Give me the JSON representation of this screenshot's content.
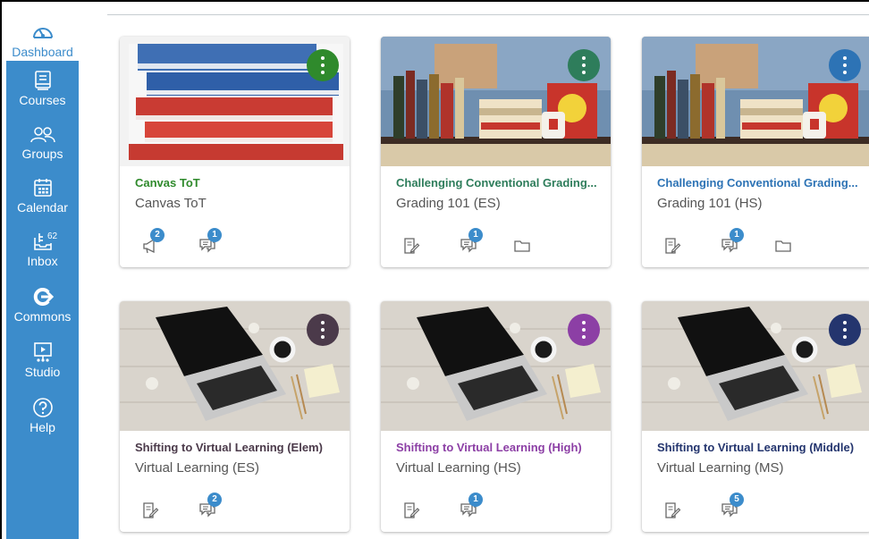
{
  "sidebar": {
    "items": [
      {
        "label": "Dashboard",
        "icon": "dashboard-gauge-icon",
        "active": true
      },
      {
        "label": "Courses",
        "icon": "book-icon"
      },
      {
        "label": "Groups",
        "icon": "groups-people-icon"
      },
      {
        "label": "Calendar",
        "icon": "calendar-icon"
      },
      {
        "label": "Inbox",
        "icon": "inbox-icon",
        "count": "62"
      },
      {
        "label": "Commons",
        "icon": "commons-icon"
      },
      {
        "label": "Studio",
        "icon": "studio-icon"
      },
      {
        "label": "Help",
        "icon": "help-circle-icon"
      }
    ]
  },
  "colors": {
    "sidebar": "#3c8ccb",
    "badge": "#3c8ccb"
  },
  "cards": [
    {
      "title": "Canvas ToT",
      "subtitle": "Canvas ToT",
      "color": "#2f8a2c",
      "image": "books-stack",
      "actions": [
        {
          "type": "announcements",
          "badge": "2"
        },
        {
          "type": "discussions",
          "badge": "1"
        }
      ]
    },
    {
      "title": "Challenging Conventional Grading...",
      "subtitle": "Grading 101 (ES)",
      "color": "#2e7d5b",
      "image": "bookshelf",
      "actions": [
        {
          "type": "assignments"
        },
        {
          "type": "discussions",
          "badge": "1"
        },
        {
          "type": "files"
        }
      ]
    },
    {
      "title": "Challenging Conventional Grading...",
      "subtitle": "Grading 101 (HS)",
      "color": "#2d73b5",
      "image": "bookshelf",
      "actions": [
        {
          "type": "assignments"
        },
        {
          "type": "discussions",
          "badge": "1"
        },
        {
          "type": "files"
        }
      ]
    },
    {
      "title": "Shifting to Virtual Learning (Elem)",
      "subtitle": "Virtual Learning (ES)",
      "color": "#4b3a4a",
      "image": "laptop",
      "actions": [
        {
          "type": "assignments"
        },
        {
          "type": "discussions",
          "badge": "2"
        }
      ]
    },
    {
      "title": "Shifting to Virtual Learning (High)",
      "subtitle": "Virtual Learning (HS)",
      "color": "#8c3fa5",
      "image": "laptop",
      "actions": [
        {
          "type": "assignments"
        },
        {
          "type": "discussions",
          "badge": "1"
        }
      ]
    },
    {
      "title": "Shifting to Virtual Learning (Middle)",
      "subtitle": "Virtual Learning (MS)",
      "color": "#24356e",
      "image": "laptop",
      "actions": [
        {
          "type": "assignments"
        },
        {
          "type": "discussions",
          "badge": "5"
        }
      ]
    }
  ]
}
